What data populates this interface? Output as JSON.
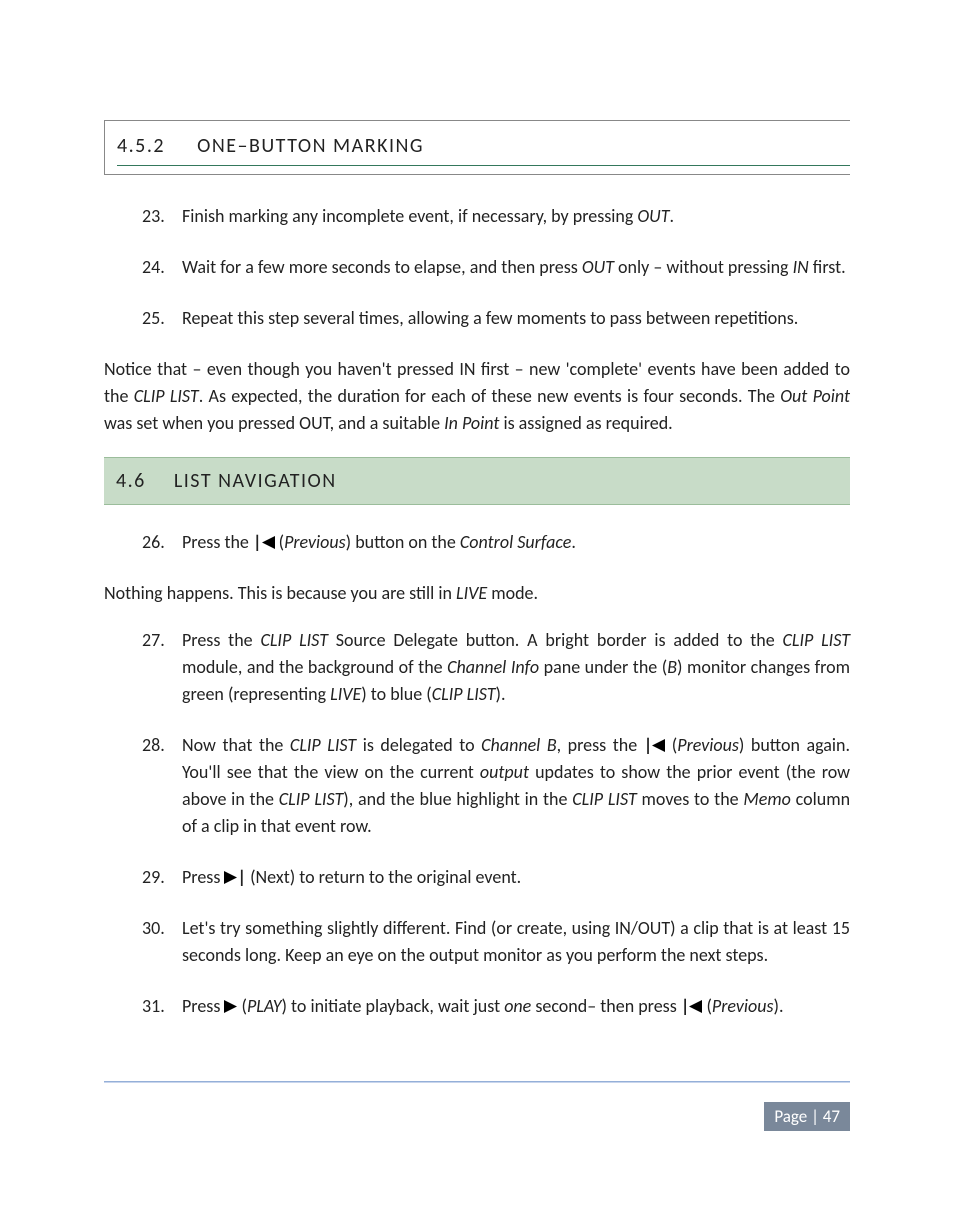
{
  "section452": {
    "number": "4.5.2",
    "title": "ONE–BUTTON MARKING"
  },
  "steps_a": [
    {
      "n": "23.",
      "pre": "Finish marking any incomplete event, if necessary, by pressing ",
      "i1": "OUT",
      "post": "."
    },
    {
      "n": "24.",
      "pre": "Wait for a few more seconds to elapse, and then press ",
      "i1": "OUT",
      "mid": " only – without pressing ",
      "i2": "IN",
      "post": " first."
    },
    {
      "n": "25.",
      "pre": "Repeat this step several times, allowing a few moments to pass between repetitions."
    }
  ],
  "para1": {
    "t1": "Notice that – even though you haven't pressed IN first – new 'complete' events have been added to the ",
    "i1": "CLIP LIST",
    "t2": ".  As expected, the duration for each of these new events is four seconds.  The ",
    "i2": "Out Point",
    "t3": " was set when you pressed OUT, and a suitable ",
    "i3": "In Point",
    "t4": " is assigned as required."
  },
  "section46": {
    "number": "4.6",
    "title": "LIST NAVIGATION"
  },
  "step26": {
    "n": "26.",
    "t1": "Press the ",
    "b1": "|",
    "t2": " (",
    "i1": "Previous",
    "t3": ") button on the ",
    "i2": "Control Surface",
    "t4": "."
  },
  "para2": {
    "t1": "Nothing happens.  This is because you are still in ",
    "i1": "LIVE",
    "t2": " mode."
  },
  "step27": {
    "n": "27.",
    "t1": "Press the ",
    "i1": "CLIP LIST",
    "t2": " Source Delegate button.  A bright border is added to the ",
    "i2": "CLIP LIST",
    "t3": " module, and the background of the ",
    "i3": "Channel Info",
    "t4": " pane under the (",
    "i4": "B",
    "t5": ") monitor changes from green (representing ",
    "i5": "LIVE",
    "t6": ") to blue (",
    "i6": "CLIP LIST",
    "t7": ")."
  },
  "step28": {
    "n": "28.",
    "t1": "Now that the ",
    "i1": "CLIP LIST",
    "t2": " is delegated to ",
    "i2": "Channel B",
    "t3": ", press the ",
    "b1": "|",
    "t4": " (",
    "i3": "Previous",
    "t5": ") button again. You'll see that the view on the current ",
    "i4": "output",
    "t6": " updates to show the prior event (the row above in the ",
    "i5": "CLIP LIST",
    "t7": "), and the blue highlight in the ",
    "i6": "CLIP LIST",
    "t8": " moves to the ",
    "i7": "Memo",
    "t9": " column of a clip in that event row."
  },
  "step29": {
    "n": "29.",
    "t1": "Press ",
    "b1": "|",
    "t2": " (Next) to return to the original event."
  },
  "step30": {
    "n": "30.",
    "t1": "Let's try something slightly different. Find (or create, using IN/OUT) a clip that is at least 15 seconds long.  Keep an eye on the output monitor as you perform the next steps."
  },
  "step31": {
    "n": "31.",
    "t1": "Press ",
    "t2": " (",
    "i1": "PLAY",
    "t3": ") to initiate playback, wait just ",
    "i2": "one",
    "t4": " second– then press ",
    "b1": "|",
    "t5": " (",
    "i3": "Previous",
    "t6": ")."
  },
  "footer": {
    "label": "Page | 47"
  }
}
